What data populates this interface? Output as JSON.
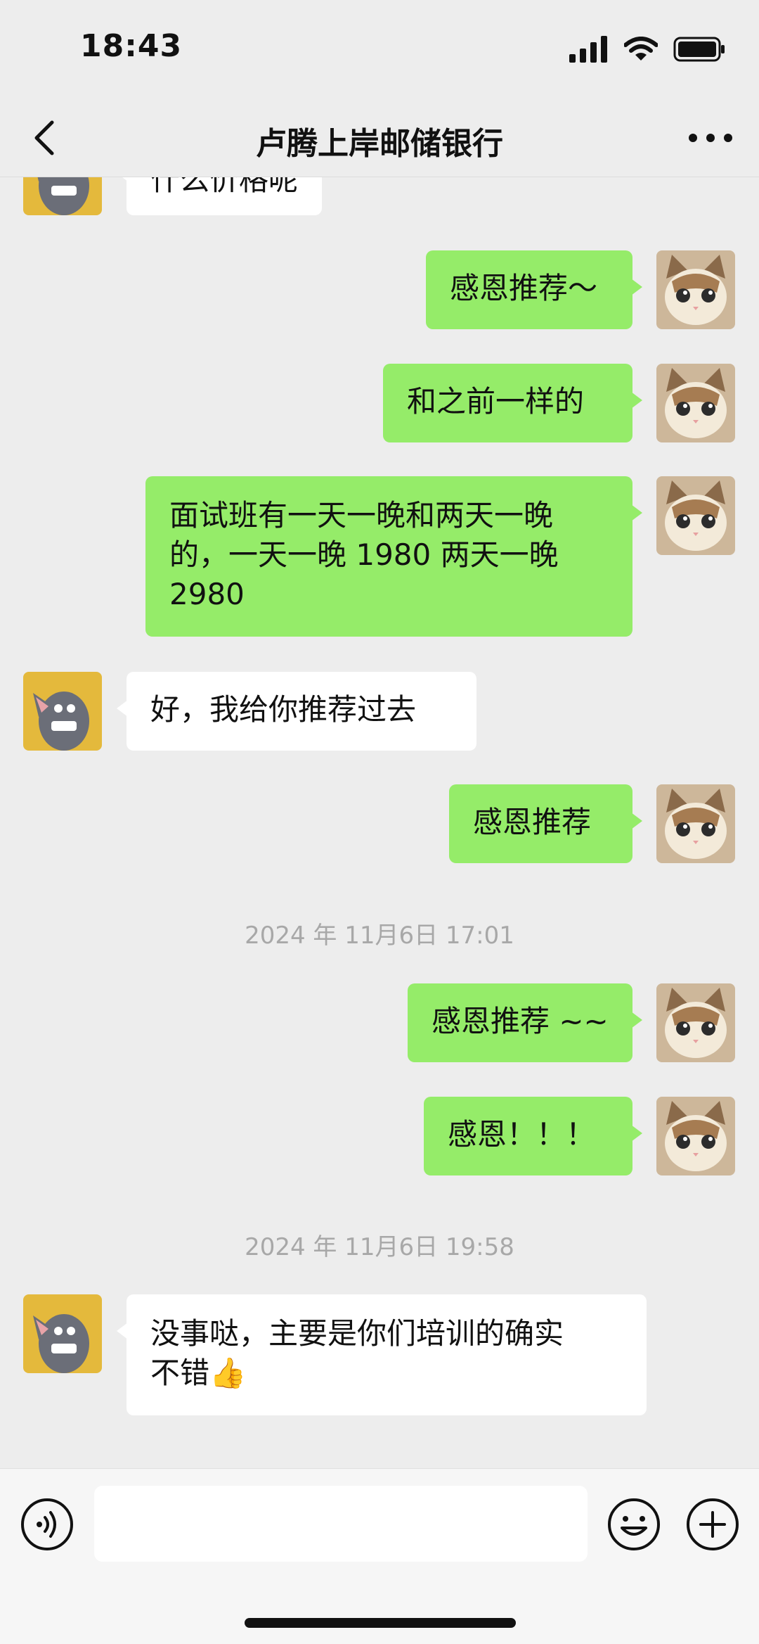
{
  "status_bar": {
    "time": "18:43"
  },
  "nav": {
    "title": "卢腾上岸邮储银行"
  },
  "messages": [
    {
      "text": "什么价格呢"
    },
    {
      "text": "感恩推荐～"
    },
    {
      "text": "和之前一样的"
    },
    {
      "line1": "面试班有一天一晚和两天一晚",
      "line2": "的，一天一晚 1980  两天一晚",
      "line3": "2980"
    },
    {
      "text": "好，我给你推荐过去"
    },
    {
      "text": "感恩推荐"
    },
    {
      "timestamp": "2024 年 11月6日 17:01"
    },
    {
      "text": "感恩推荐 ~~"
    },
    {
      "text": "感恩！！！"
    },
    {
      "timestamp": "2024 年 11月6日 19:58"
    },
    {
      "line1": "没事哒，主要是你们培训的确实",
      "line2": "不错",
      "emoji": "👍"
    }
  ],
  "input": {
    "value": "",
    "placeholder": ""
  },
  "icons": {
    "back": "chevron-left-icon",
    "more": "more-dots-icon",
    "voice": "voice-icon",
    "emoji": "emoji-icon",
    "plus": "plus-icon",
    "contact_avatar": "cartoon-cat-avatar",
    "self_avatar": "kitten-avatar"
  },
  "colors": {
    "background": "#ededed",
    "sent_bubble": "#95ec69",
    "received_bubble": "#ffffff",
    "timestamp": "#a8a8a8"
  }
}
